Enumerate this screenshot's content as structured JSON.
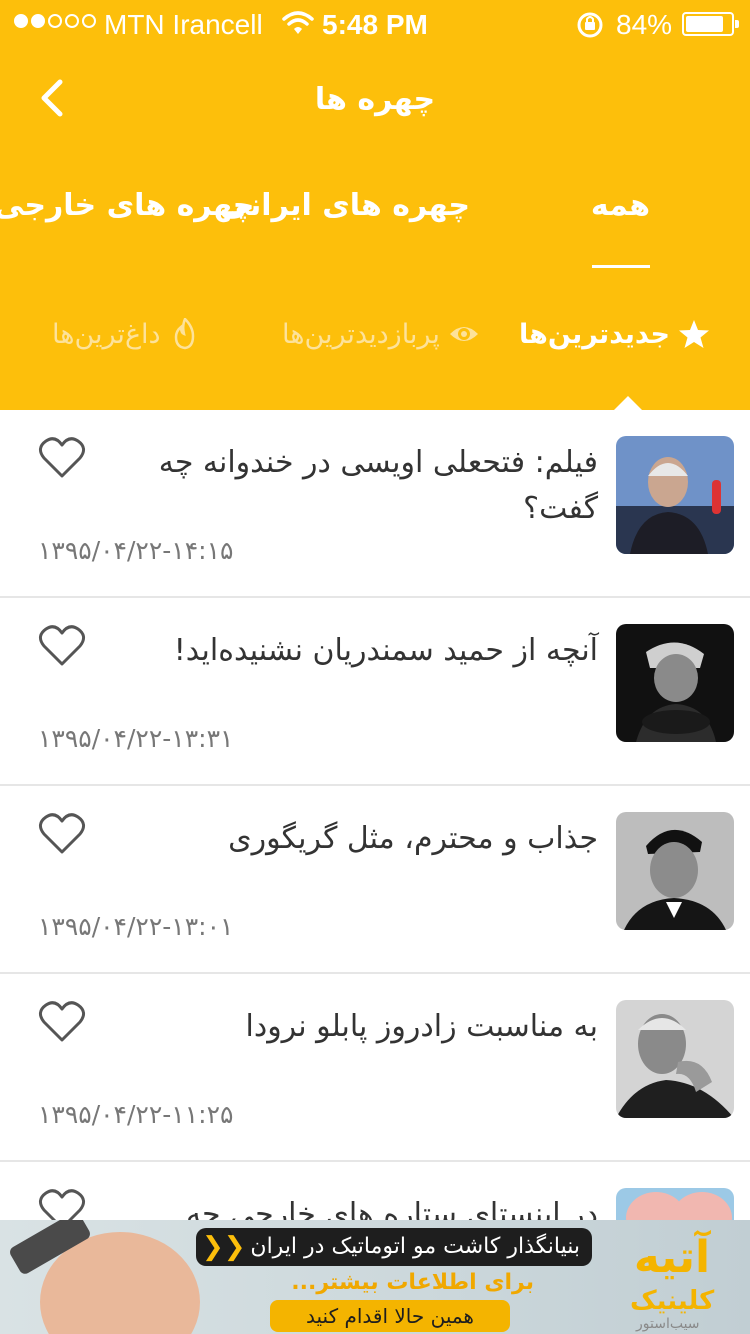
{
  "status_bar": {
    "carrier": "MTN Irancell",
    "time": "5:48 PM",
    "battery_percent": "84%",
    "battery_level": 0.84,
    "signal_bars_filled": 2,
    "signal_bars_total": 5
  },
  "nav": {
    "title": "چهره ها",
    "back_icon": "chevron-left-icon"
  },
  "categories": {
    "all": "همه",
    "iranian": "چهره های ایرانی",
    "foreign": "چهره های خارجی",
    "selected": "all"
  },
  "sort_tabs": {
    "newest": "جدیدترین‌ها",
    "most_viewed": "پربازدیدترین‌ها",
    "hottest": "داغ‌ترین‌ها",
    "selected": "newest"
  },
  "articles": [
    {
      "title": "فیلم: فتحعلی اویسی در خندوانه چه گفت؟",
      "date": "۱۳۹۵/۰۴/۲۲-۱۴:۱۵"
    },
    {
      "title": "آنچه از حمید سمندریان نشنیده‌اید!",
      "date": "۱۳۹۵/۰۴/۲۲-۱۳:۳۱"
    },
    {
      "title": "جذاب و محترم، مثل گریگوری",
      "date": "۱۳۹۵/۰۴/۲۲-۱۳:۰۱"
    },
    {
      "title": "به مناسبت زادروز پابلو نرودا",
      "date": "۱۳۹۵/۰۴/۲۲-۱۱:۲۵"
    },
    {
      "title": "در اینستای ستاره های خارجی چه",
      "date": ""
    }
  ],
  "ad": {
    "headline": "بنیانگذار کاشت مو اتوماتیک در ایران",
    "info": "برای اطلاعات بیشتر...",
    "cta": "همین حالا اقدام کنید",
    "brand": "آتیه",
    "brand_sub": "کلینیک",
    "watermark": "سیب‌استور",
    "accent": "#f4b400"
  },
  "colors": {
    "header_bg": "#fdbf0b",
    "text_primary": "#333333",
    "text_muted": "#777777"
  }
}
